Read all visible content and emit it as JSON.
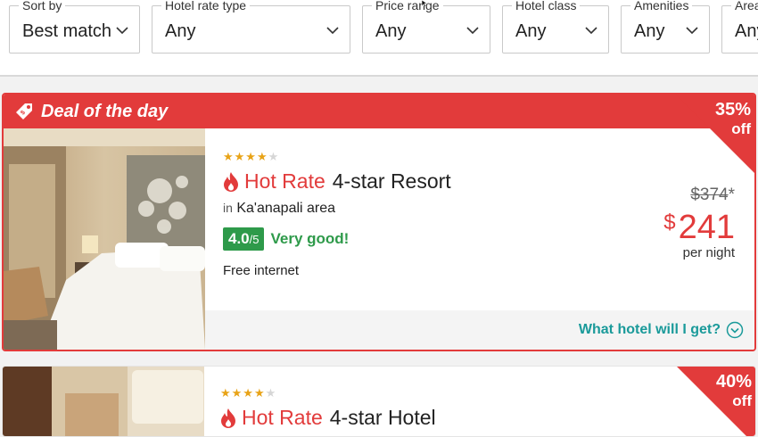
{
  "filters": [
    {
      "label": "Sort by",
      "value": "Best match"
    },
    {
      "label": "Hotel rate type",
      "value": "Any"
    },
    {
      "label": "Price range",
      "value": "Any"
    },
    {
      "label": "Hotel class",
      "value": "Any"
    },
    {
      "label": "Amenities",
      "value": "Any"
    },
    {
      "label": "Area",
      "value": "Any"
    }
  ],
  "deal": {
    "header": "Deal of the day",
    "stars": "★★★★",
    "stars_empty": "★",
    "hot_label": "Hot Rate",
    "hotel_name": "4-star Resort",
    "area_prefix": "in",
    "area": "Ka'anapali area",
    "rating": "4.0",
    "rating_of": "/5",
    "rating_text": "Very good!",
    "amenity": "Free internet",
    "discount_pct": "35%",
    "discount_off": "off",
    "old_price": "$374",
    "old_price_mark": "*",
    "currency": "$",
    "price": "241",
    "per_night": "per night",
    "what_link": "What hotel will I get?"
  },
  "card2": {
    "stars": "★★★★",
    "stars_empty": "★",
    "hot_label": "Hot Rate",
    "hotel_name": "4-star Hotel",
    "discount_pct": "40%",
    "discount_off": "off"
  },
  "colors": {
    "accent_red": "#e23b3b",
    "rating_green": "#2e9a4a",
    "link_teal": "#1a9a9a",
    "star_gold": "#e8a317"
  },
  "icons": [
    "chevron-down-icon",
    "price-tag-icon",
    "flame-icon",
    "chevron-circle-icon",
    "mouse-cursor-icon"
  ]
}
